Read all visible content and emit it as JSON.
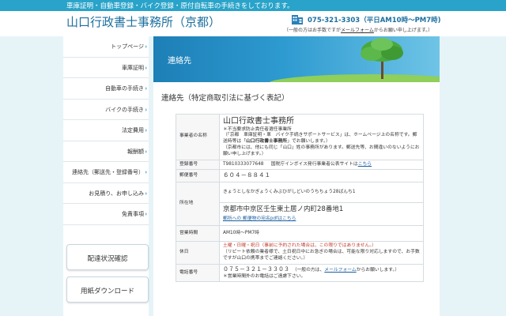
{
  "topbar": {
    "text": "車庫証明・自動車登録・バイク登録・原付自転車の手続きをしております。"
  },
  "header": {
    "site_title": "山口行政書士事務所（京都）",
    "phone_line": "075-321-3303（平日AM10時～PM7時)",
    "phone_note_prefix": "（一般の方はお手数ですが",
    "phone_note_link": "メールフォーム",
    "phone_note_suffix": "からお願い申し上げます。）",
    "phone_icon": "building-icon"
  },
  "sidebar": {
    "items": [
      {
        "label": "トップページ"
      },
      {
        "label": "車庫証明"
      },
      {
        "label": "自動車の手続き"
      },
      {
        "label": "バイクの手続き"
      },
      {
        "label": "法定費用"
      },
      {
        "label": "報酬額"
      },
      {
        "label": "連絡先（郵送先・登録番号）"
      },
      {
        "label": "お見積り、お申し込み"
      },
      {
        "label": "免責事項"
      }
    ],
    "buttons": [
      {
        "label": "配達状況確認"
      },
      {
        "label": "用紙ダウンロード"
      }
    ]
  },
  "main": {
    "banner_title": "連絡先",
    "section_title": "連絡先（特定商取引法に基づく表記）",
    "rows": {
      "business": {
        "label": "事業者の名称",
        "name": "山口行政書士事務所",
        "line1": "＊不当要求防止責任者選任事業所",
        "line2": "（「京都　車庫証明・車　バイク手続きサポートサービス」は、ホームページ上の名称です。郵送時等は「",
        "line2_bold": "山口行政書士事務所",
        "line2_end": "」でお願いします。）",
        "line3": "（京都市には、他にも同じ「山口」姓の事務所があります。郵送先等、お間違いのないようにお願い申し上げます。）"
      },
      "registration": {
        "label": "登録番号",
        "number": "T9810333077648",
        "text": "国税庁インボイス発行事業者公表サイトは",
        "link": "こちら"
      },
      "postal": {
        "label": "郵便番号",
        "value": "６０４－８８４１"
      },
      "address": {
        "label": "所在地",
        "kana": "きょうとしなかぎょうくみぶひがしどいのうちちょう28ばんち1",
        "value": "京都市中京区壬生東土居ノ内町28番地1",
        "link": "郵所への 郵便物の宛名pdfは",
        "link2": "こちら"
      },
      "hours": {
        "label": "営業時間",
        "value": "AM10時～PM7時"
      },
      "holidays": {
        "label": "休日",
        "line1": "土曜・日曜・祝日（事前に予約された場合は、この限りではありません。）",
        "line2": "（リピート依頼の業者様で、土日祝日中にお急ぎの場合は、可能な限り対応しますので、お手数ですが山口の携帯までご連絡ください。）"
      },
      "phone": {
        "label": "電話番号",
        "value": "０７５－３２１－３３０３",
        "note_prefix": "（一般の方は、",
        "note_link": "メールフォーム",
        "note_suffix": "からお願いします。）",
        "line2": "＊営業時間外のお電話はご遠慮下さい。"
      }
    }
  }
}
